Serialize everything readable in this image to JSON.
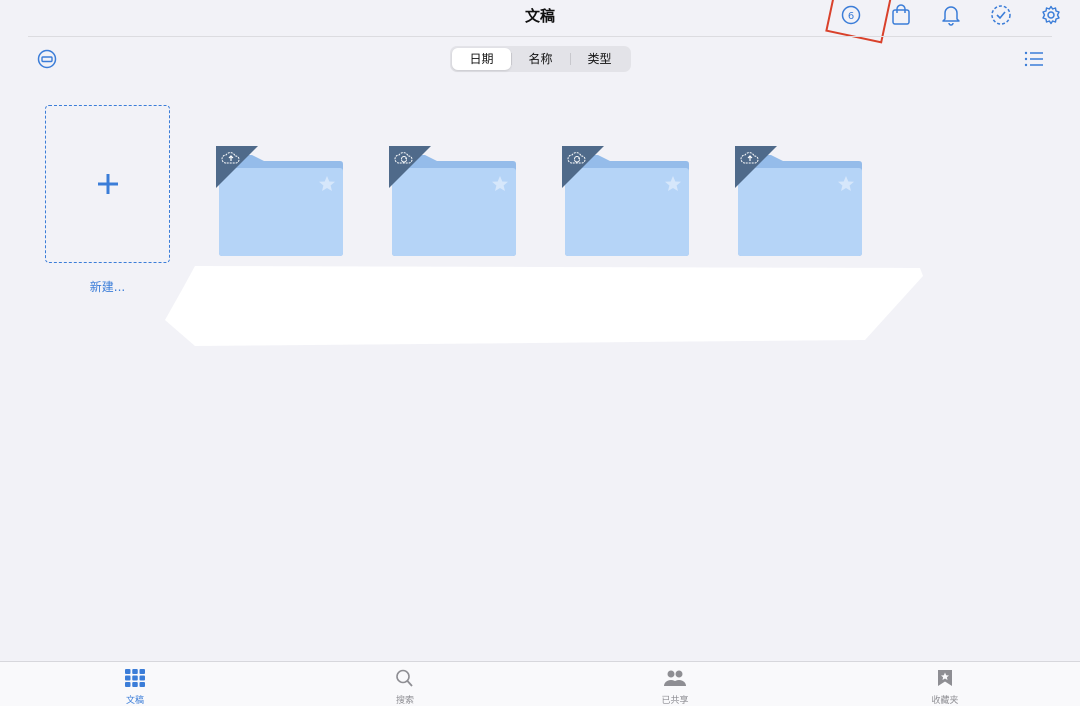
{
  "header": {
    "title": "文稿",
    "icons": [
      "progress-6-icon",
      "shopping-bag-icon",
      "bell-icon",
      "check-badge-icon",
      "gear-icon"
    ],
    "progress_number": "6"
  },
  "sort_control": {
    "options": [
      "日期",
      "名称",
      "类型"
    ],
    "selected": "日期"
  },
  "new_item": {
    "label": "新建..."
  },
  "folders": [
    {
      "badge_icon": "cloud-upload-icon",
      "starred": false
    },
    {
      "badge_icon": "cloud-sync-icon",
      "starred": false
    },
    {
      "badge_icon": "cloud-sync-icon",
      "starred": false
    },
    {
      "badge_icon": "cloud-upload-icon",
      "starred": false
    }
  ],
  "tabbar": {
    "items": [
      {
        "label": "文稿",
        "icon": "grid-icon",
        "active": true
      },
      {
        "label": "搜索",
        "icon": "search-icon",
        "active": false
      },
      {
        "label": "已共享",
        "icon": "people-icon",
        "active": false
      },
      {
        "label": "收藏夹",
        "icon": "bookmark-star-icon",
        "active": false
      }
    ]
  },
  "colors": {
    "accent": "#3b7dd8",
    "folder_body": "#b5d4f7",
    "folder_tab": "#95bcea",
    "badge": "#4f6a8a",
    "annotation_red": "#d9412b",
    "background": "#f2f2f7"
  }
}
